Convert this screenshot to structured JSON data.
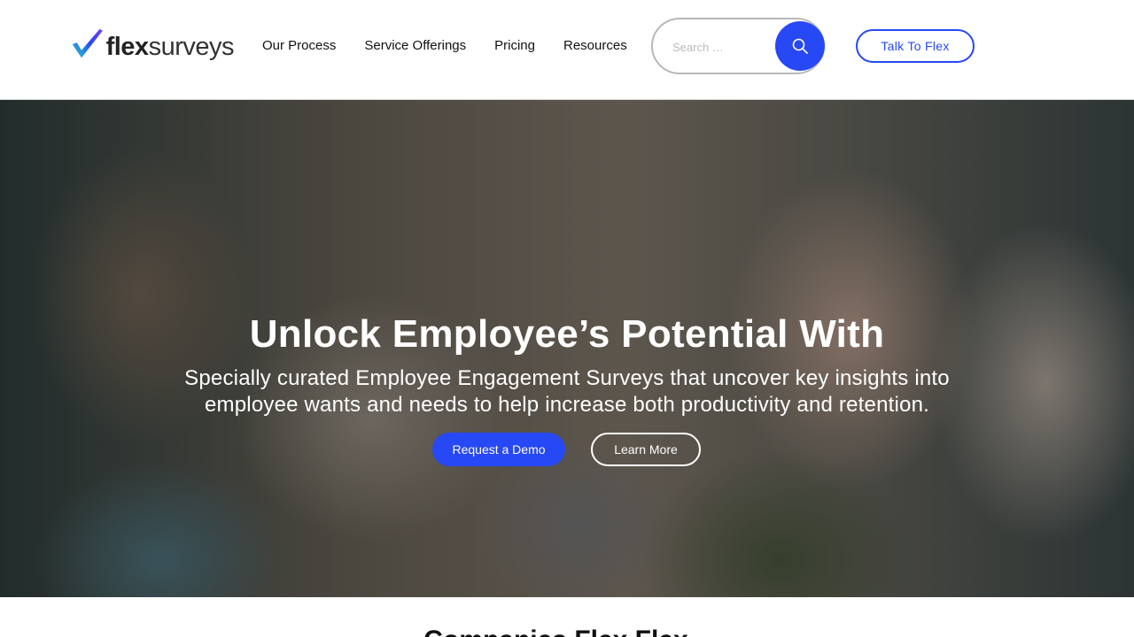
{
  "brand": {
    "logo_bold": "flex",
    "logo_light": "surveys",
    "primary_color": "#2748f5",
    "logo_gradient": [
      "#27d4c4",
      "#2748f5",
      "#7b3df5"
    ]
  },
  "nav": {
    "items": [
      {
        "label": "Our Process"
      },
      {
        "label": "Service Offerings"
      },
      {
        "label": "Pricing"
      },
      {
        "label": "Resources"
      }
    ]
  },
  "search": {
    "placeholder": "Search …",
    "button_icon": "search-icon"
  },
  "header": {
    "cta_label": "Talk To Flex"
  },
  "hero": {
    "title": "Unlock Employee’s Potential With",
    "subtitle": "Specially curated Employee Engagement Surveys that uncover key insights into employee wants and needs to help increase both productivity and retention.",
    "primary_button": "Request a Demo",
    "secondary_button": "Learn More"
  },
  "section": {
    "heading": "Companies Flex Flex..."
  }
}
